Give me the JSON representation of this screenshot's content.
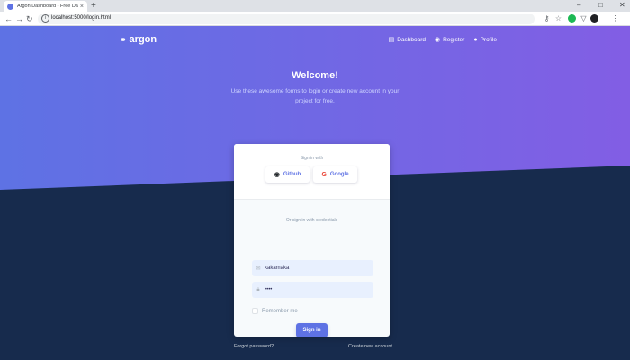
{
  "browser": {
    "tab_title": "Argon Dashboard - Free Dashb...",
    "tab_close": "×",
    "new_tab": "+",
    "url": "localhost:5000/login.html",
    "window_controls": {
      "minimize": "–",
      "maximize": "□",
      "close": "✕"
    }
  },
  "navbar": {
    "brand": "argon",
    "links": [
      {
        "label": "Dashboard",
        "icon": "dashboard-icon"
      },
      {
        "label": "Register",
        "icon": "register-icon"
      },
      {
        "label": "Profile",
        "icon": "profile-icon"
      }
    ]
  },
  "hero": {
    "title": "Welcome!",
    "lead": "Use these awesome forms to login or create new account in your project for free."
  },
  "card": {
    "signin_with": "Sign in with",
    "github_label": "Github",
    "google_label": "Google",
    "google_glyph": "G",
    "or_text": "Or sign in with credentials",
    "email_value": "kakamaka",
    "password_value": "••••",
    "remember_label": "Remember me",
    "signin_button": "Sign in"
  },
  "footer": {
    "forgot": "Forgot password?",
    "create": "Create new account"
  },
  "colors": {
    "primary": "#5e72e4",
    "gradient_end": "#825ee4",
    "dark_bg": "#172b4d"
  }
}
